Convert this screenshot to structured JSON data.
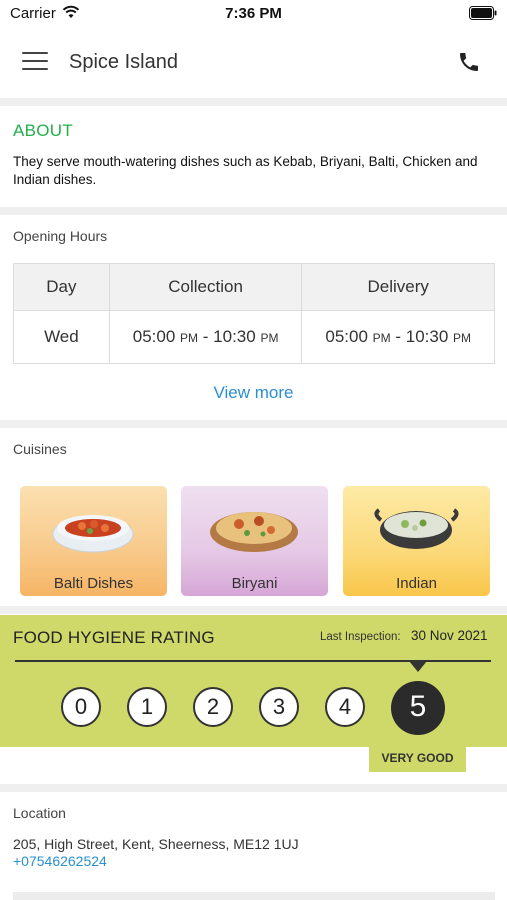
{
  "status_bar": {
    "carrier": "Carrier",
    "time": "7:36 PM"
  },
  "header": {
    "title": "Spice Island"
  },
  "about": {
    "heading": "ABOUT",
    "text": "They serve mouth-watering dishes such as Kebab, Briyani, Balti, Chicken and Indian dishes."
  },
  "opening_hours": {
    "label": "Opening Hours",
    "columns": [
      "Day",
      "Collection",
      "Delivery"
    ],
    "rows": [
      {
        "day": "Wed",
        "collection": {
          "open": "05:00",
          "open_suffix": "PM",
          "sep": " - ",
          "close": "10:30",
          "close_suffix": "PM"
        },
        "delivery": {
          "open": "05:00",
          "open_suffix": "PM",
          "sep": " - ",
          "close": "10:30",
          "close_suffix": "PM"
        }
      }
    ],
    "view_more": "View more"
  },
  "cuisines": {
    "label": "Cuisines",
    "items": [
      {
        "name": "Balti Dishes",
        "icon": "curry-bowl-icon"
      },
      {
        "name": "Biryani",
        "icon": "biryani-plate-icon"
      },
      {
        "name": "Indian",
        "icon": "karahi-dish-icon"
      }
    ]
  },
  "hygiene": {
    "title": "FOOD HYGIENE RATING",
    "inspection_label": "Last Inspection:",
    "inspection_date": "30 Nov 2021",
    "scale": [
      "0",
      "1",
      "2",
      "3",
      "4",
      "5"
    ],
    "rating": "5",
    "rating_text": "VERY GOOD"
  },
  "location": {
    "label": "Location",
    "address": "205, High Street, Kent, Sheerness, ME12 1UJ",
    "phone": "+07546262524"
  }
}
